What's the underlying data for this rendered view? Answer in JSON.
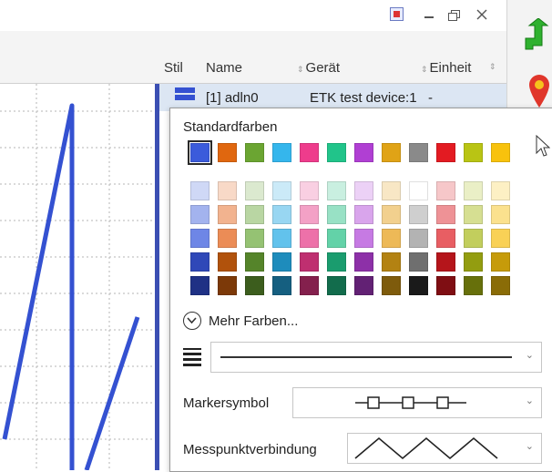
{
  "header": {
    "col_stil": "Stil",
    "col_name": "Name",
    "col_geraet": "Gerät",
    "col_einheit": "Einheit",
    "sort_glyph": "⇕"
  },
  "row": {
    "name": "[1] adln0",
    "device": "ETK test device:1",
    "unit": "-"
  },
  "popup": {
    "standard_label": "Standardfarben",
    "more_colors_label": "Mehr Farben...",
    "marker_label": "Markersymbol",
    "connection_label": "Messpunktverbindung",
    "dropdown_caret": "⌄",
    "standard_colors": [
      "#3b5bdb",
      "#e0670f",
      "#6ba532",
      "#35b6ec",
      "#ee3c8c",
      "#21c48a",
      "#b03fd3",
      "#e0a316",
      "#8a8a8a",
      "#e31b22",
      "#b9c414",
      "#f8c20d"
    ],
    "palette": [
      [
        "#cfd8f6",
        "#f8d9c7",
        "#dbe9cf",
        "#cbeaf8",
        "#f9cfe2",
        "#c9efe0",
        "#ecd1f6",
        "#f8e7c5",
        "#ffffff",
        "#f6c7c9",
        "#eaefc6",
        "#fdf0c4"
      ],
      [
        "#a3b3ee",
        "#f2b38f",
        "#b9d6a3",
        "#98d6f2",
        "#f3a1c6",
        "#98e1c5",
        "#d9a5ec",
        "#f2d08e",
        "#cfcfcf",
        "#ee9296",
        "#d6df92",
        "#fbe18e"
      ],
      [
        "#6e86e6",
        "#eb8c56",
        "#95c273",
        "#62c2ec",
        "#ed71a9",
        "#63d2a8",
        "#c67ae3",
        "#edb957",
        "#b3b3b3",
        "#e85e63",
        "#c2ce5d",
        "#f9d156"
      ],
      [
        "#2f48b8",
        "#b1520c",
        "#55842a",
        "#1e8cbc",
        "#bf2f70",
        "#1a9c6e",
        "#8d30a8",
        "#b38212",
        "#6f6f6f",
        "#b5151b",
        "#939d10",
        "#c69b0a"
      ],
      [
        "#1f3185",
        "#7c3908",
        "#3c5d1d",
        "#155f80",
        "#84204d",
        "#126c4c",
        "#622174",
        "#7e5b0c",
        "#1a1a1a",
        "#7f0e13",
        "#67700b",
        "#8a6c07"
      ]
    ]
  },
  "icons": {
    "collapse_icon": "⌄",
    "line_style_icon": "≡"
  },
  "colors": {
    "accent": "#3b4fb3",
    "plot_line": "#3451d1"
  }
}
